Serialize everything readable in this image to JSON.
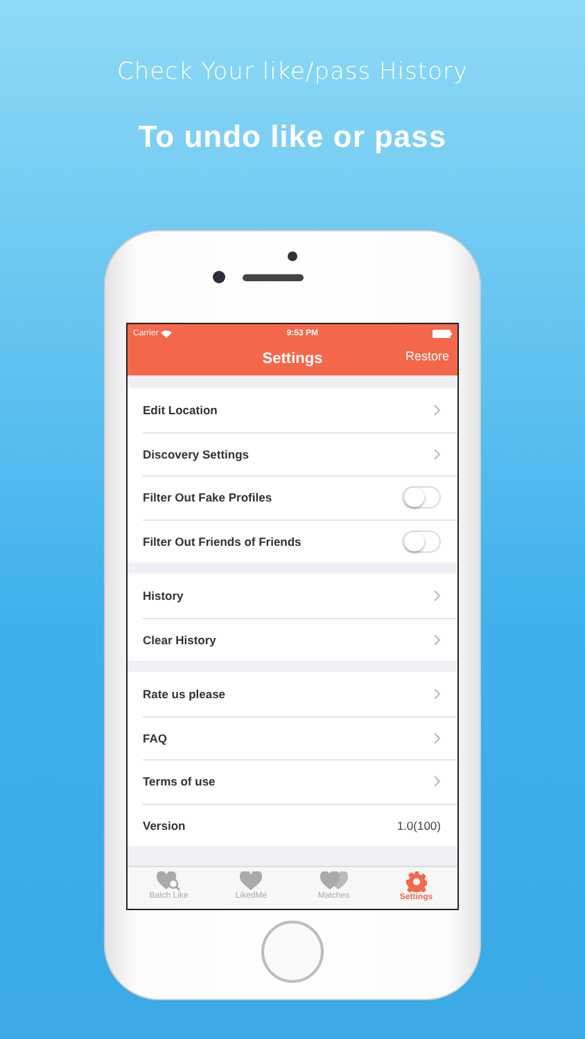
{
  "headline": "Check Your like/pass History",
  "subheadline": "To undo like or pass",
  "status_bar": {
    "carrier": "Carrier",
    "time": "9:53 PM"
  },
  "nav": {
    "title": "Settings",
    "action": "Restore"
  },
  "sections": [
    [
      {
        "kind": "link",
        "label": "Edit Location"
      },
      {
        "kind": "link",
        "label": "Discovery Settings"
      },
      {
        "kind": "toggle",
        "label": "Filter Out Fake Profiles",
        "on": false
      },
      {
        "kind": "toggle",
        "label": "Filter Out Friends of Friends",
        "on": false
      }
    ],
    [
      {
        "kind": "link",
        "label": "History"
      },
      {
        "kind": "link",
        "label": "Clear History"
      }
    ],
    [
      {
        "kind": "link",
        "label": "Rate us please"
      },
      {
        "kind": "link",
        "label": "FAQ"
      },
      {
        "kind": "link",
        "label": "Terms of use"
      },
      {
        "kind": "value",
        "label": "Version",
        "value": "1.0(100)"
      }
    ]
  ],
  "tabs": [
    {
      "kind": "batch",
      "label": "Batch Like",
      "selected": false
    },
    {
      "kind": "liked",
      "label": "LikedMe",
      "selected": false
    },
    {
      "kind": "matches",
      "label": "Matches",
      "selected": false
    },
    {
      "kind": "settings",
      "label": "Settings",
      "selected": true
    }
  ]
}
